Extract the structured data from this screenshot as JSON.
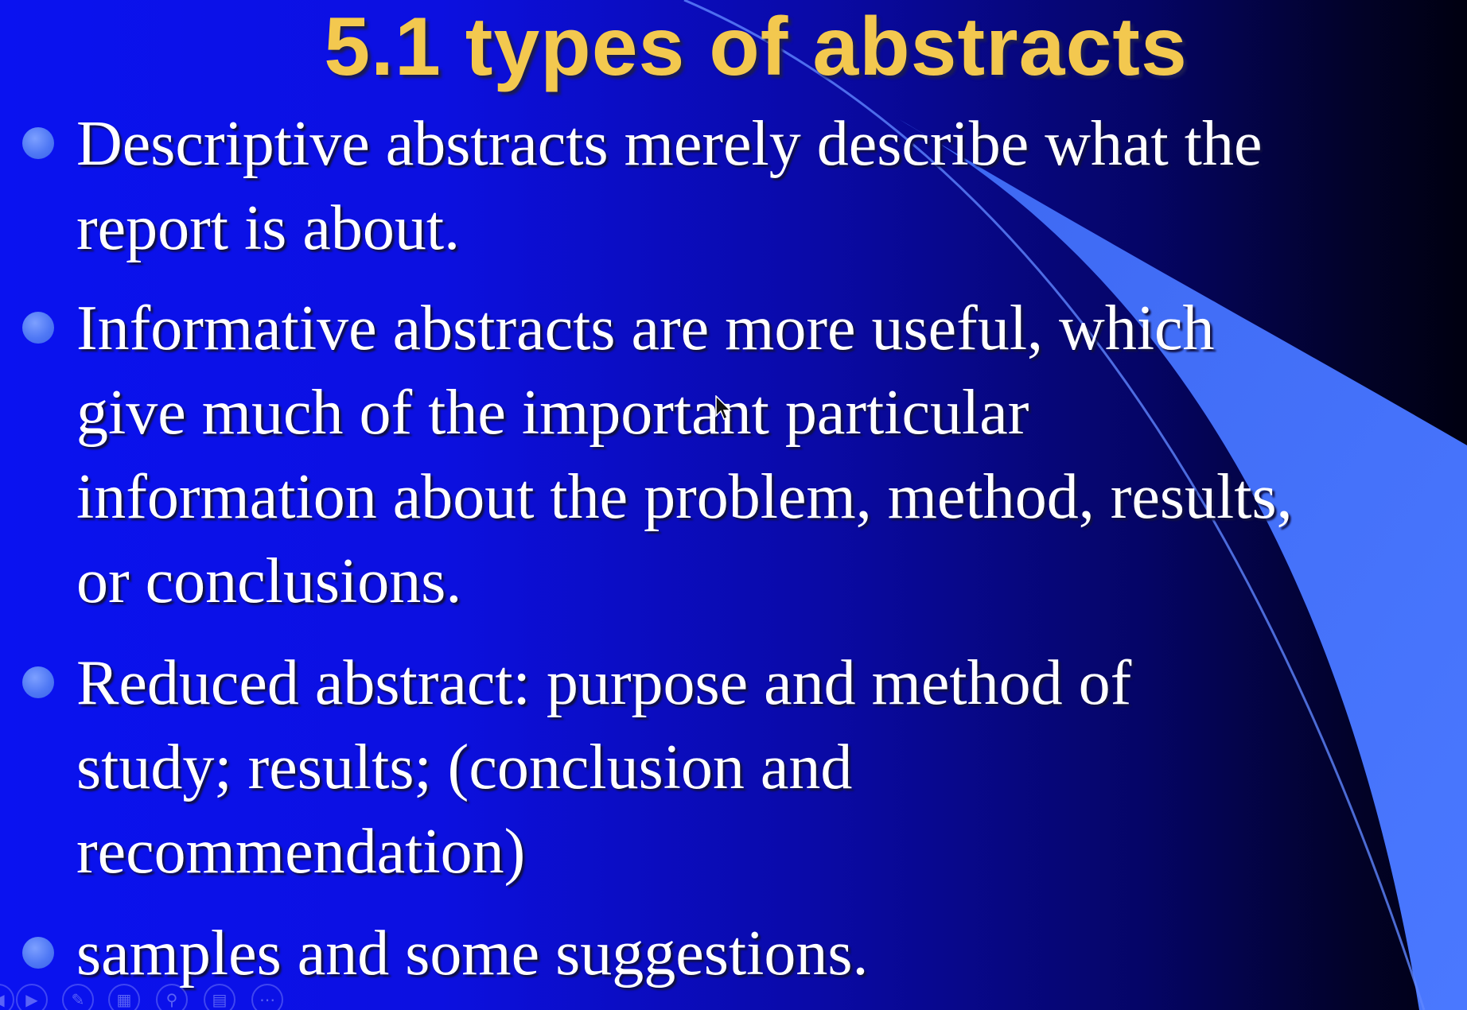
{
  "slide": {
    "title": "5.1 types of abstracts",
    "bullets": [
      {
        "lines": [
          "Descriptive abstracts merely describe what the",
          "report is about."
        ]
      },
      {
        "lines": [
          "Informative abstracts are more useful, which",
          "give much of the important particular",
          "information about the problem, method, results,",
          "or conclusions."
        ]
      },
      {
        "lines": [
          "Reduced abstract: purpose and method of",
          "study; results; (conclusion and",
          "recommendation)"
        ]
      },
      {
        "lines": [
          "samples and some suggestions."
        ]
      }
    ]
  },
  "toolbar": {
    "buttons": [
      {
        "icon": "previous-icon"
      },
      {
        "icon": "play-icon"
      },
      {
        "icon": "pen-icon"
      },
      {
        "icon": "slides-icon"
      },
      {
        "icon": "zoom-icon"
      },
      {
        "icon": "subtitles-icon"
      },
      {
        "icon": "more-icon"
      }
    ]
  },
  "colors": {
    "title": "#f3c84f",
    "text": "#ffffff",
    "background": "#0a12f0",
    "accent": "#4f78f5"
  }
}
